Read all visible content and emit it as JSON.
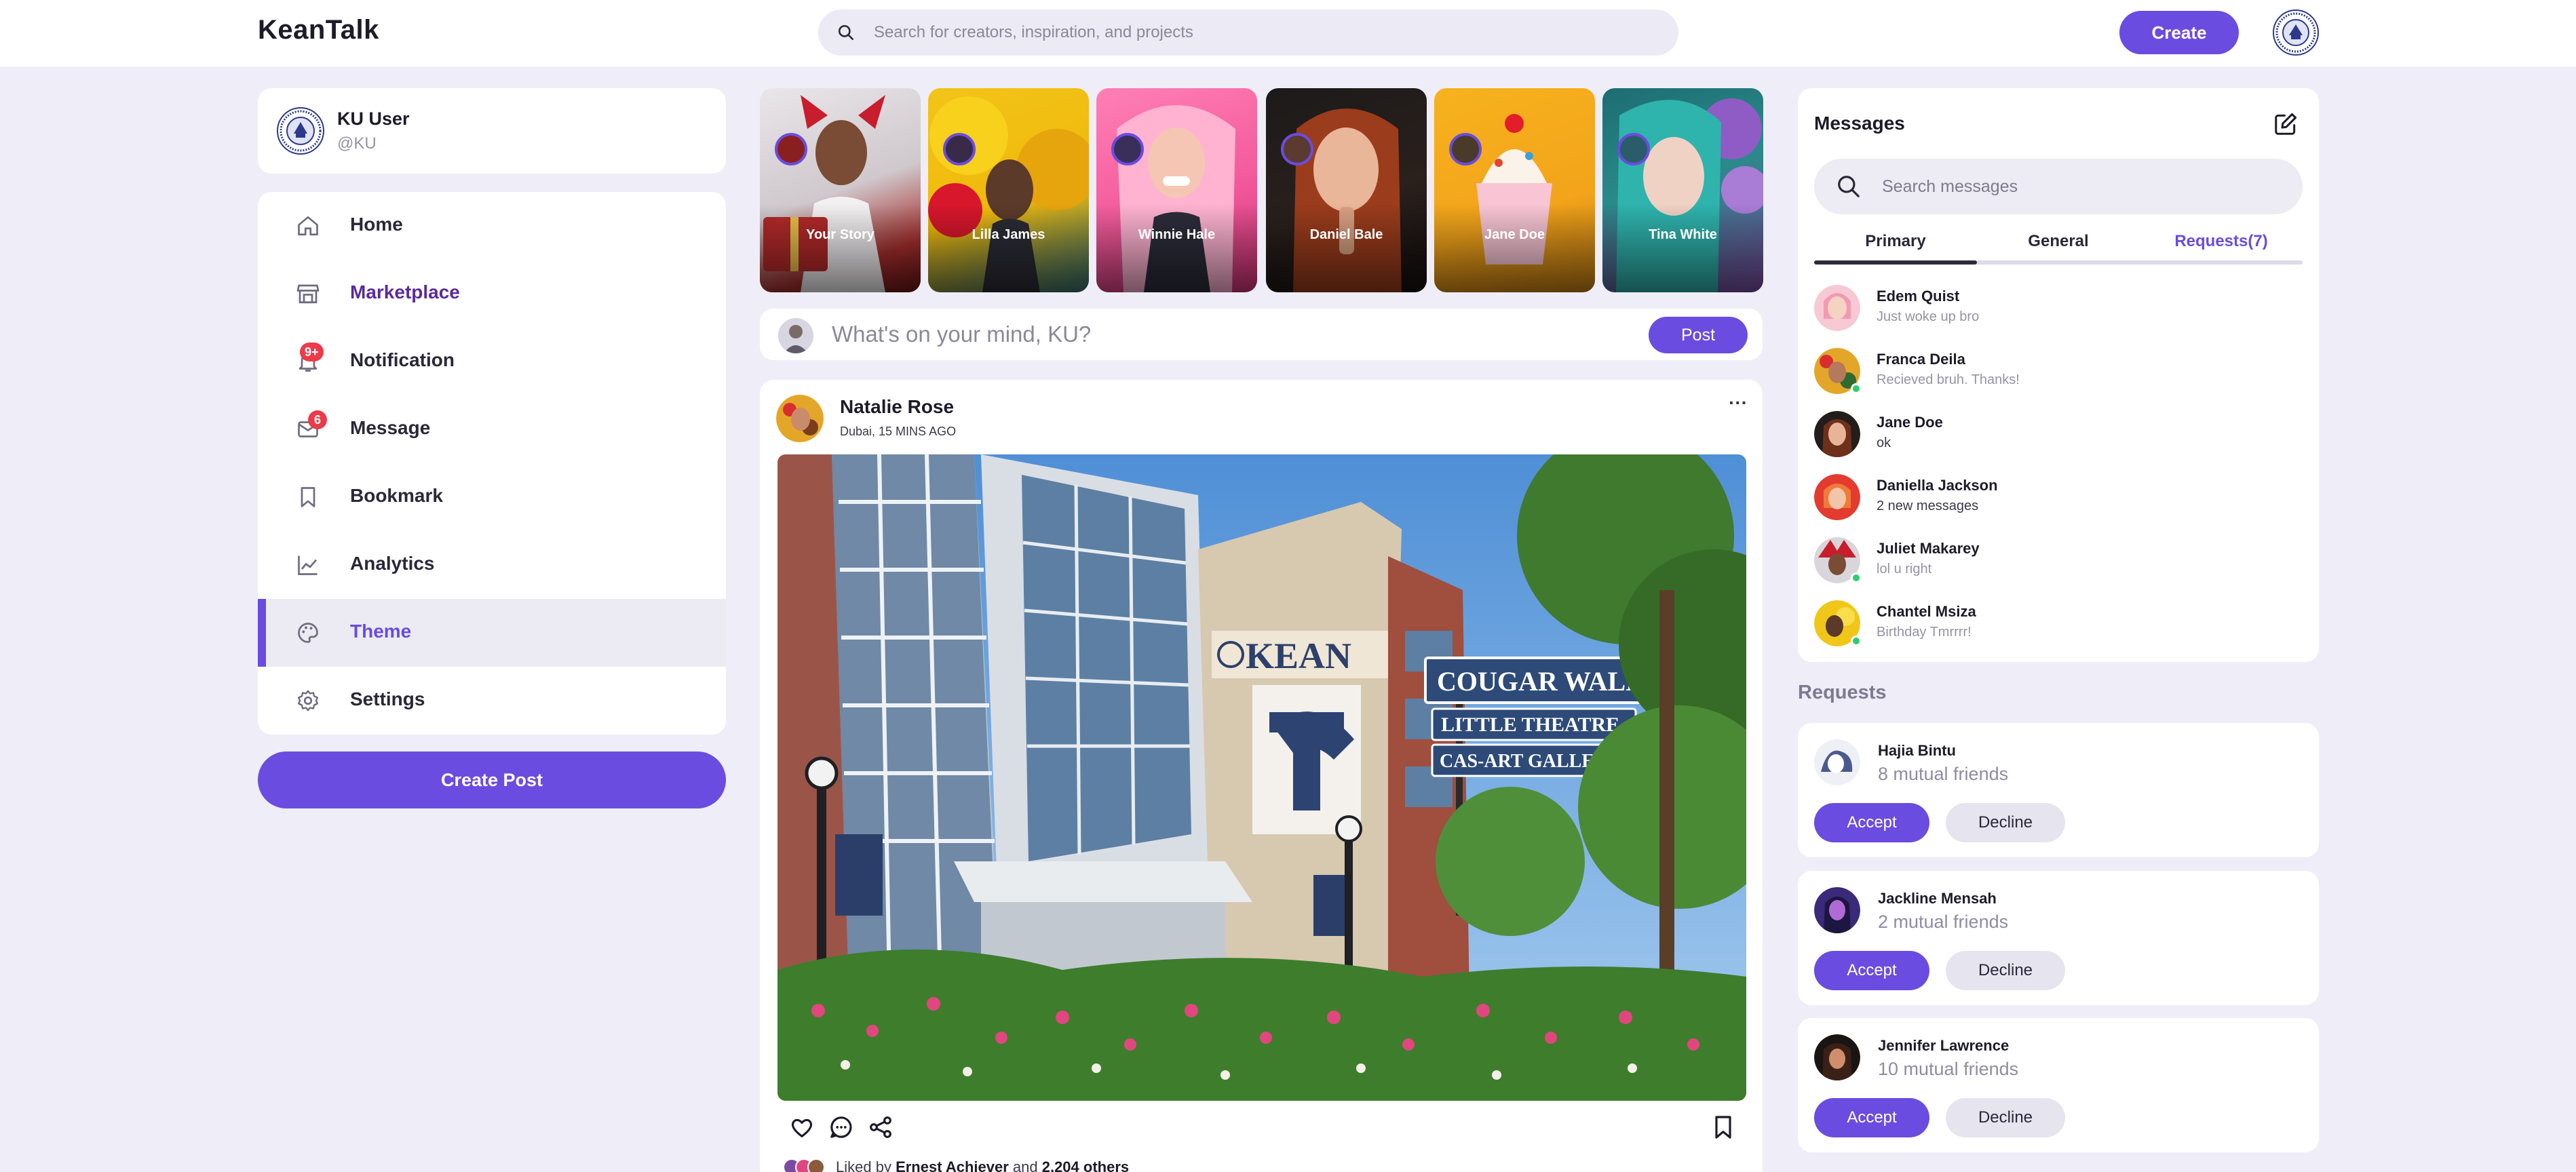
{
  "app": {
    "name": "KeanTalk"
  },
  "topbar": {
    "search_placeholder": "Search for creators, inspiration, and projects",
    "create_label": "Create"
  },
  "profile": {
    "name": "KU User",
    "handle": "@KU"
  },
  "menu": [
    {
      "label": "Home",
      "icon": "home-icon"
    },
    {
      "label": "Marketplace",
      "icon": "store-icon"
    },
    {
      "label": "Notification",
      "icon": "bell-icon",
      "badge": "9+"
    },
    {
      "label": "Message",
      "icon": "mail-icon",
      "badge": "6"
    },
    {
      "label": "Bookmark",
      "icon": "bookmark-icon"
    },
    {
      "label": "Analytics",
      "icon": "chart-icon"
    },
    {
      "label": "Theme",
      "icon": "palette-icon",
      "active": true
    },
    {
      "label": "Settings",
      "icon": "gear-icon"
    }
  ],
  "create_post_label": "Create Post",
  "stories": [
    {
      "name": "Your Story"
    },
    {
      "name": "Lilla James"
    },
    {
      "name": "Winnie Hale"
    },
    {
      "name": "Daniel Bale"
    },
    {
      "name": "Jane Doe"
    },
    {
      "name": "Tina White"
    }
  ],
  "composer": {
    "placeholder": "What's on your mind, KU?",
    "post_label": "Post"
  },
  "post": {
    "author": "Natalie Rose",
    "meta": "Dubai, 15 MINS AGO",
    "more": "···",
    "liked_prefix": "Liked by ",
    "liked_by": "Ernest Achiever",
    "liked_mid": " and ",
    "liked_others": "2,204 others",
    "sign_lines": [
      "COUGAR WALK",
      "LITTLE THEATRE",
      "CAS-ART GALLERY"
    ],
    "building_text": "KEAN"
  },
  "messages": {
    "title": "Messages",
    "search_placeholder": "Search messages",
    "tabs": [
      "Primary",
      "General",
      "Requests(7)"
    ],
    "items": [
      {
        "name": "Edem Quist",
        "text": "Just woke up bro"
      },
      {
        "name": "Franca Deila",
        "text": "Recieved bruh. Thanks!"
      },
      {
        "name": "Jane Doe",
        "text": "ok"
      },
      {
        "name": "Daniella Jackson",
        "text": "2 new messages"
      },
      {
        "name": "Juliet Makarey",
        "text": "lol u right"
      },
      {
        "name": "Chantel Msiza",
        "text": "Birthday Tmrrrr!"
      }
    ]
  },
  "requests": {
    "title": "Requests",
    "accept_label": "Accept",
    "decline_label": "Decline",
    "items": [
      {
        "name": "Hajia Bintu",
        "mutual": "8 mutual friends"
      },
      {
        "name": "Jackline Mensah",
        "mutual": "2 mutual friends"
      },
      {
        "name": "Jennifer Lawrence",
        "mutual": "10 mutual friends"
      }
    ]
  },
  "colors": {
    "accent": "#6a4ce0",
    "page_bg": "#efedf7",
    "badge": "#ec3b4a"
  }
}
